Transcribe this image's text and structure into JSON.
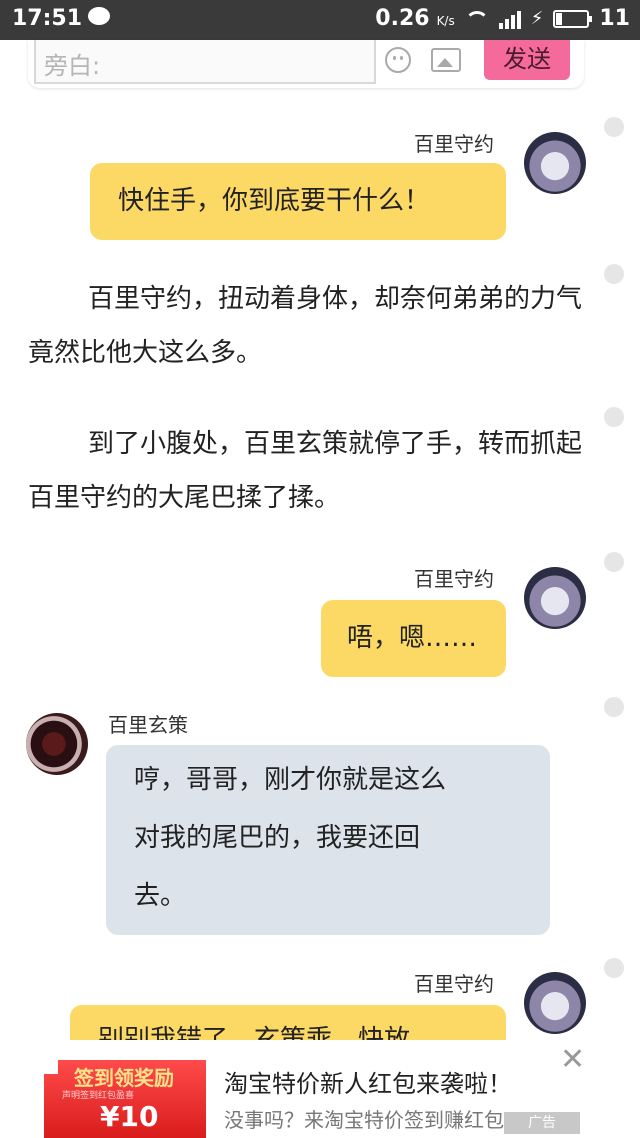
{
  "status_bar": {
    "time": "17:51",
    "speed": "0.26",
    "speed_unit": "K/s",
    "network": "4G",
    "battery": "11"
  },
  "input_bar": {
    "placeholder": "旁白:",
    "send_label": "发送"
  },
  "messages": [
    {
      "type": "bubble",
      "side": "right",
      "name": "百里守约",
      "text": "快住手，你到底要干什么！",
      "color": "#fcd965"
    },
    {
      "type": "narration",
      "text": "百里守约，扭动着身体，却奈何弟弟的力气竟然比他大这么多。"
    },
    {
      "type": "narration",
      "text": "到了小腹处，百里玄策就停了手，转而抓起百里守约的大尾巴揉了揉。"
    },
    {
      "type": "bubble",
      "side": "right",
      "name": "百里守约",
      "text": "唔，嗯……",
      "color": "#fcd965"
    },
    {
      "type": "bubble",
      "side": "left",
      "name": "百里玄策",
      "lines": [
        "哼，哥哥，刚才你就是这么",
        "对我的尾巴的，我要还回",
        "去。"
      ],
      "color": "#dce3ea"
    },
    {
      "type": "bubble",
      "side": "right",
      "name": "百里守约",
      "text": "别别我错了，玄策乖，快放",
      "color": "#fcd965"
    }
  ],
  "ad": {
    "thumb_title": "签到领奖励",
    "thumb_sub": "声明签到红包盈喜",
    "thumb_amount": "¥10",
    "title": "淘宝特价新人红包来袭啦！",
    "desc": "没事吗？来淘宝特价签到赚红包",
    "tag": "广告",
    "close": "✕"
  }
}
